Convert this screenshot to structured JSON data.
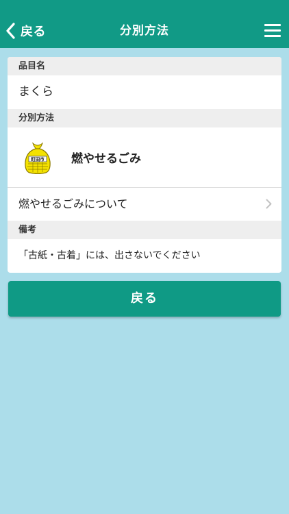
{
  "header": {
    "back_label": "戻る",
    "title": "分別方法",
    "menu_icon": "hamburger-menu-icon",
    "background_color": "#119A86"
  },
  "item": {
    "header": "品目名",
    "name": "まくら"
  },
  "method": {
    "header": "分別方法",
    "icon": "yellow-garbage-bag-icon",
    "bag_text": "町田市",
    "label": "燃やせるごみ",
    "about_link": "燃やせるごみについて"
  },
  "notes": {
    "header": "備考",
    "text": "「古紙・古着」には、出さないでください"
  },
  "footer": {
    "back_button_label": "戻る",
    "button_color": "#0F9A85"
  },
  "page_background": "#ACDDEA"
}
